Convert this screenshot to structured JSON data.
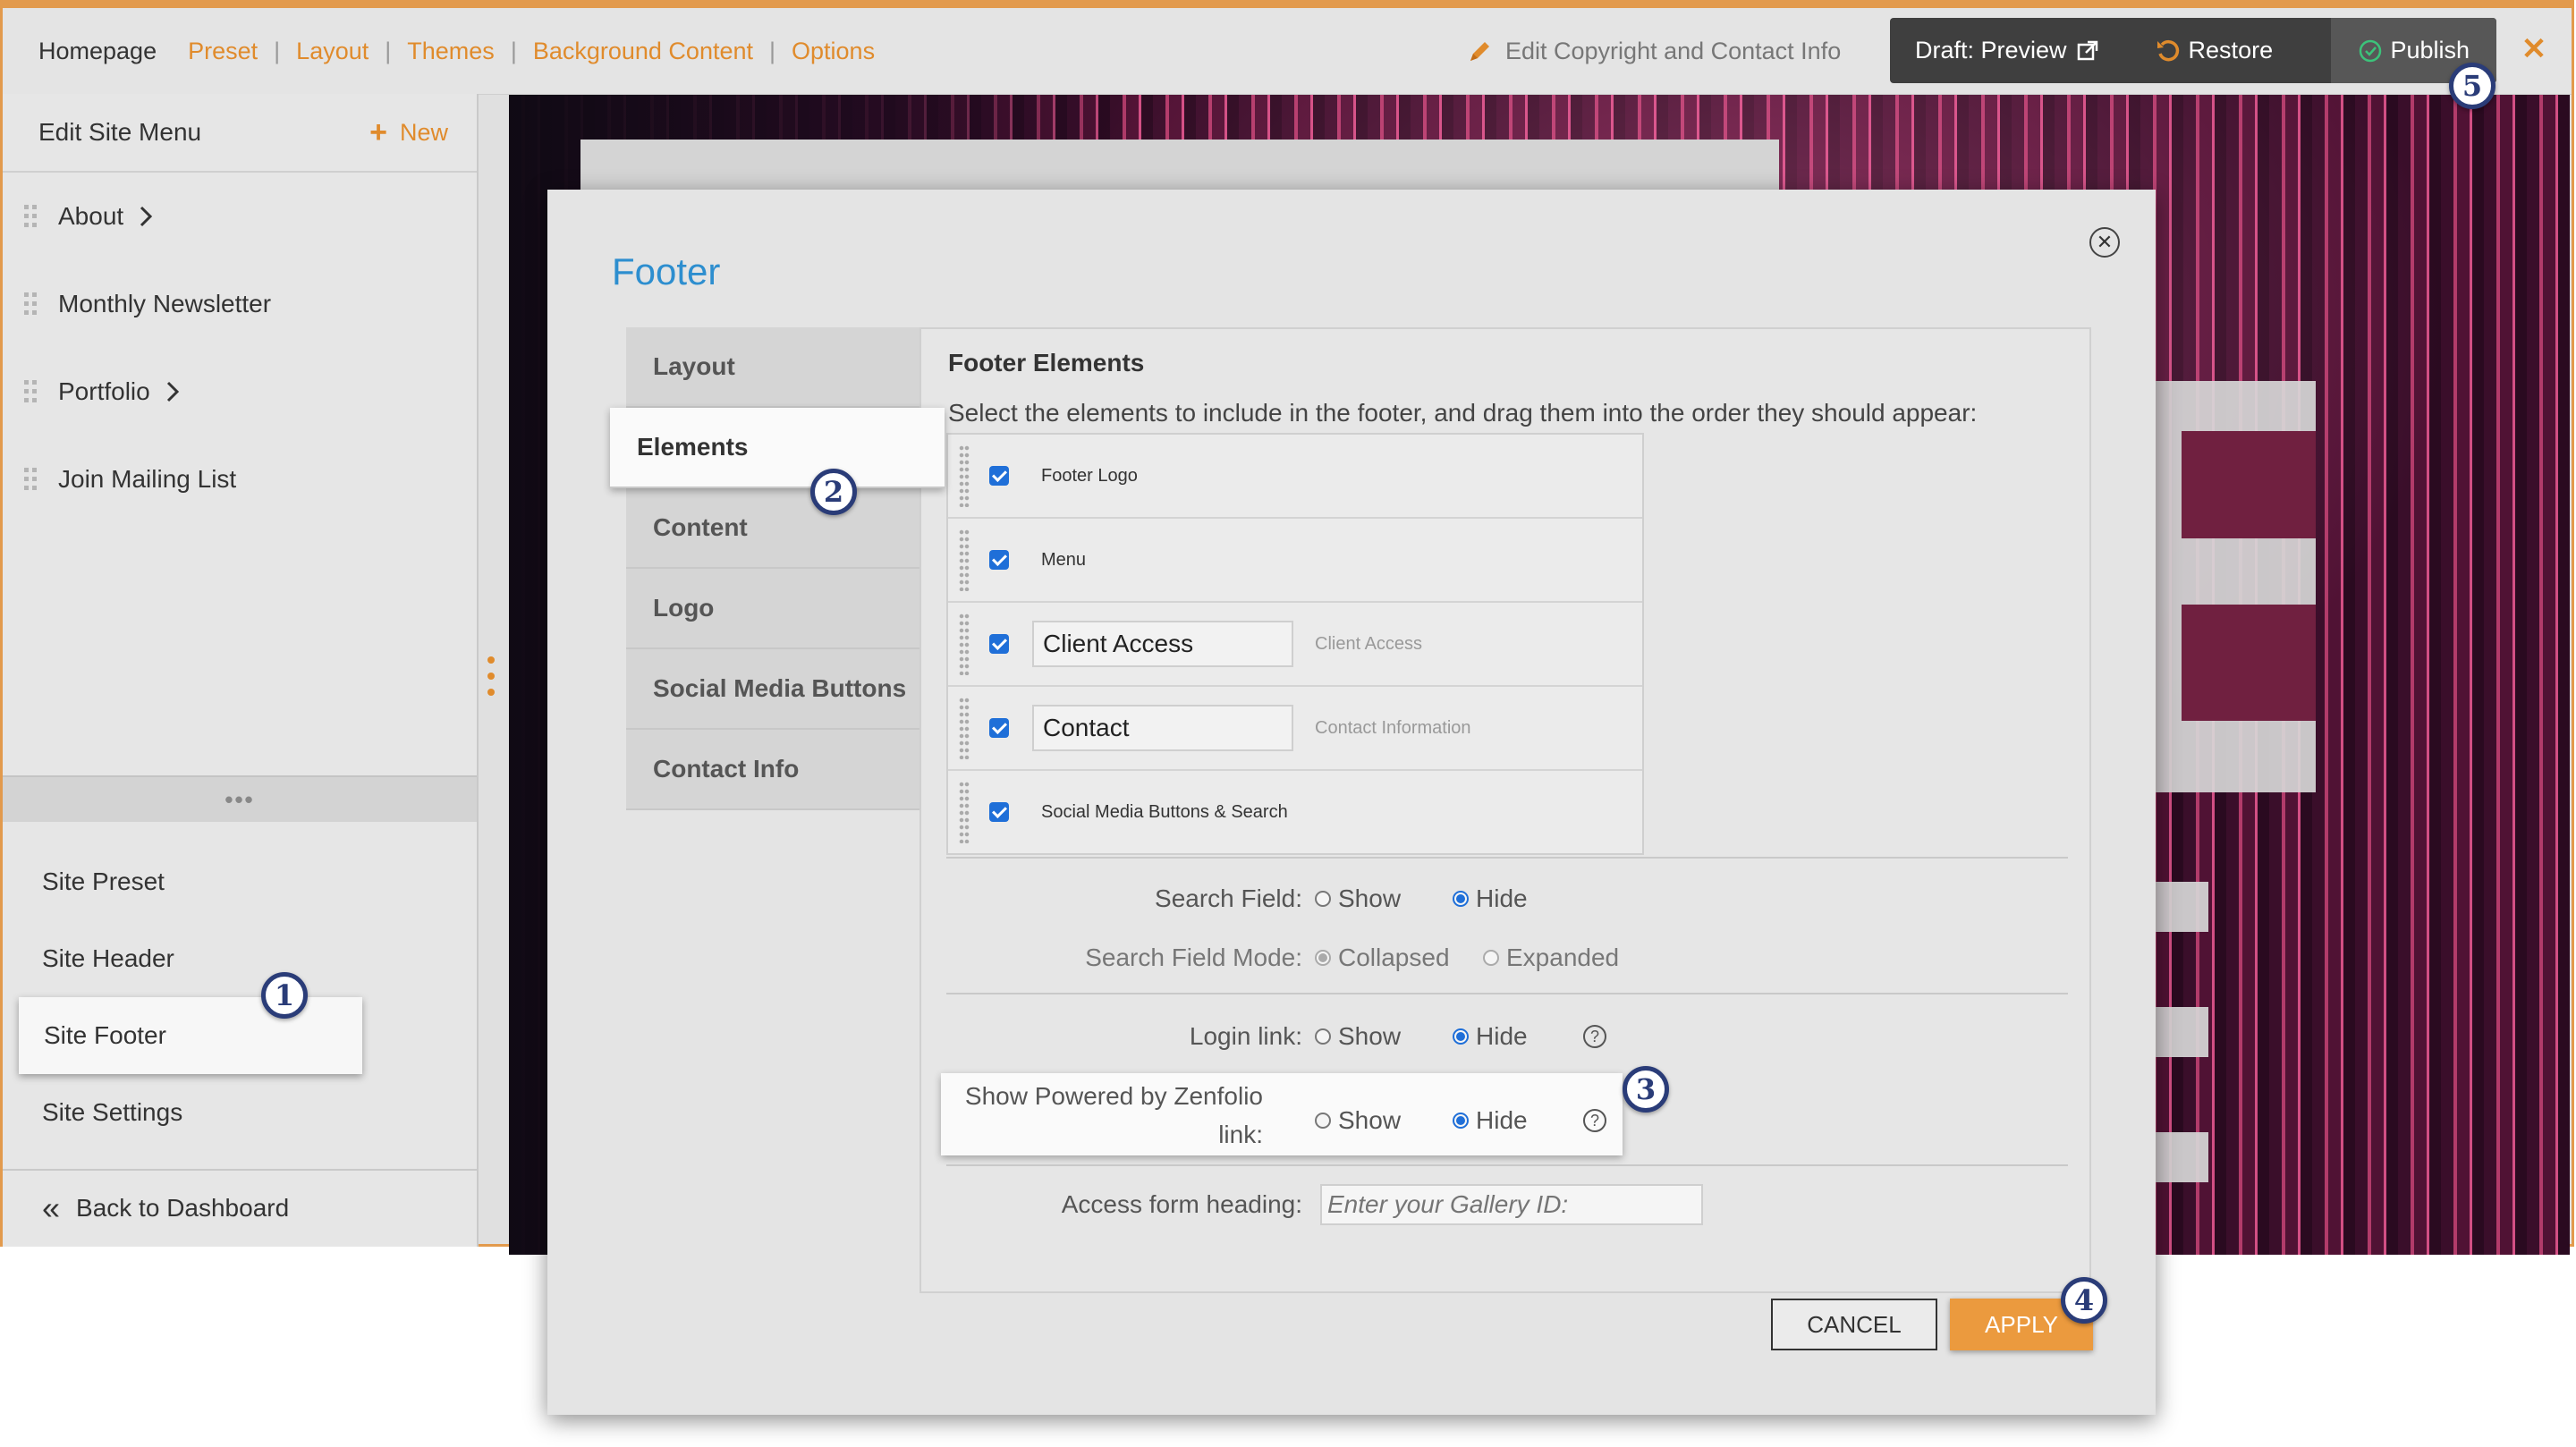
{
  "topbar": {
    "nav": [
      {
        "label": "Homepage",
        "active": true
      },
      {
        "label": "Preset"
      },
      {
        "label": "Layout"
      },
      {
        "label": "Themes"
      },
      {
        "label": "Background Content"
      },
      {
        "label": "Options"
      }
    ],
    "edit_copyright": "Edit Copyright and Contact Info",
    "draft_preview": "Draft: Preview",
    "restore": "Restore",
    "publish": "Publish",
    "close_symbol": "✕"
  },
  "sidebar": {
    "title": "Edit Site Menu",
    "new_label": "New",
    "menu_items": [
      {
        "label": "About",
        "has_children": true
      },
      {
        "label": "Monthly Newsletter",
        "has_children": false
      },
      {
        "label": "Portfolio",
        "has_children": true
      },
      {
        "label": "Join Mailing List",
        "has_children": false
      }
    ],
    "site_items": [
      "Site Preset",
      "Site Header",
      "Site Footer",
      "Site Settings"
    ],
    "selected_site_item": "Site Footer",
    "back_label": "Back to Dashboard"
  },
  "modal": {
    "title": "Footer",
    "tabs": [
      "Layout",
      "Elements",
      "Content",
      "Logo",
      "Social Media Buttons",
      "Contact Info"
    ],
    "active_tab": "Elements",
    "heading": "Footer Elements",
    "intro": "Select the elements to include in the footer, and drag them into the order they should appear:",
    "elements": [
      {
        "label": "Footer Logo",
        "checked": true
      },
      {
        "label": "Menu",
        "checked": true
      },
      {
        "value": "Client Access",
        "hint": "Client Access",
        "checked": true
      },
      {
        "value": "Contact",
        "hint": "Contact Information",
        "checked": true
      },
      {
        "label": "Social Media Buttons & Search",
        "checked": true
      }
    ],
    "search_field": {
      "label": "Search Field:",
      "show": "Show",
      "hide": "Hide",
      "selected": "Hide"
    },
    "search_mode": {
      "label": "Search Field Mode:",
      "collapsed": "Collapsed",
      "expanded": "Expanded",
      "selected": "Collapsed"
    },
    "login_link": {
      "label": "Login link:",
      "show": "Show",
      "hide": "Hide",
      "selected": "Hide",
      "help": "?"
    },
    "powered_by": {
      "label_line1": "Show Powered by Zenfolio",
      "label_line2": "link:",
      "show": "Show",
      "hide": "Hide",
      "selected": "Hide",
      "help": "?"
    },
    "access_heading": {
      "label": "Access form heading:",
      "placeholder": "Enter your Gallery ID:"
    },
    "cancel": "CANCEL",
    "apply": "APPLY",
    "close_symbol": "✕"
  },
  "callouts": [
    "1",
    "2",
    "3",
    "4",
    "5"
  ],
  "colors": {
    "accent": "#e08b2c",
    "title_blue": "#2d8ecf",
    "callout_navy": "#2a3c78",
    "checkbox_blue": "#1f6fd8"
  }
}
